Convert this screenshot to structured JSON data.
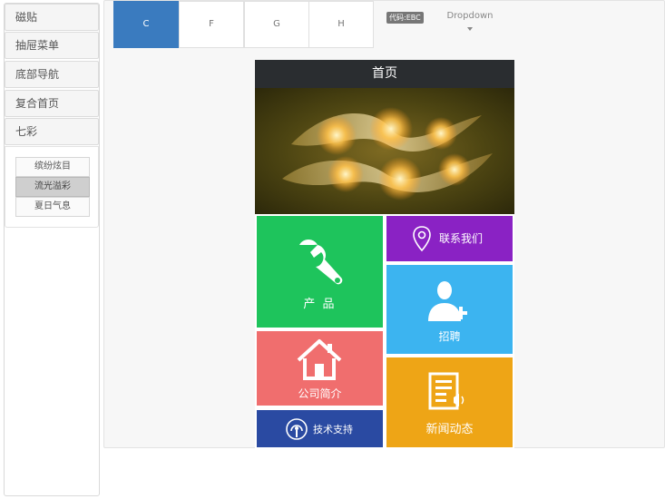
{
  "sidebar": {
    "items": [
      {
        "label": "磁贴"
      },
      {
        "label": "抽屉菜单"
      },
      {
        "label": "底部导航"
      },
      {
        "label": "复合首页"
      },
      {
        "label": "七彩"
      }
    ],
    "sub_items": [
      {
        "label": "缤纷炫目",
        "active": false
      },
      {
        "label": "流光溢彩",
        "active": true
      },
      {
        "label": "夏日气息",
        "active": false
      }
    ]
  },
  "tabs": [
    {
      "label": "C",
      "active": true
    },
    {
      "label": "F",
      "active": false
    },
    {
      "label": "G",
      "active": false
    },
    {
      "label": "H",
      "active": false
    }
  ],
  "badge": "代码:EBC",
  "dropdown": {
    "label": "Dropdown"
  },
  "phone": {
    "title": "首页",
    "tiles": {
      "products": {
        "label": "产 品",
        "color": "#1ec45c",
        "icon": "wrench-icon"
      },
      "contact": {
        "label": "联系我们",
        "color": "#8a22c4",
        "icon": "map-pin-icon"
      },
      "recruit": {
        "label": "招聘",
        "color": "#3cb4f0",
        "icon": "add-user-icon"
      },
      "about": {
        "label": "公司简介",
        "color": "#f06e6e",
        "icon": "house-icon"
      },
      "news": {
        "label": "新闻动态",
        "color": "#eea516",
        "icon": "news-icon"
      },
      "support": {
        "label": "技术支持",
        "color": "#2a4aa2",
        "icon": "podcast-icon"
      }
    }
  },
  "colors": {
    "tab_active": "#3a7bbf",
    "phone_header": "#2a2d30"
  }
}
